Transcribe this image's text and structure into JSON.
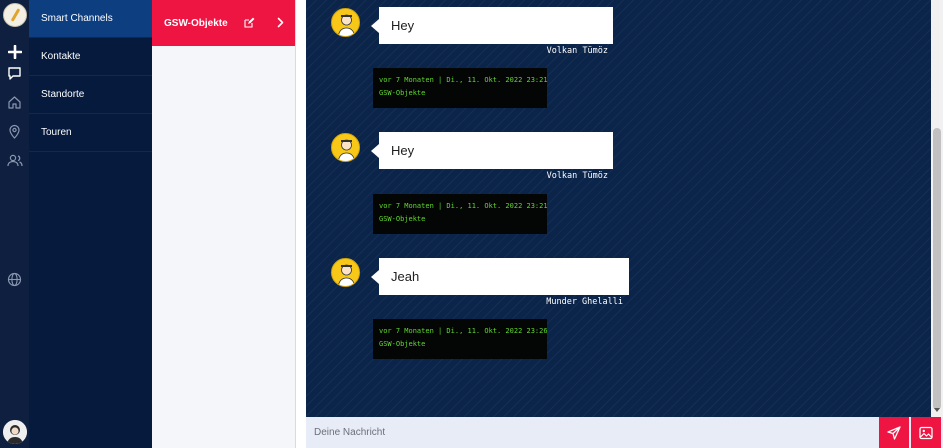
{
  "nav": {
    "items": [
      {
        "label": "Smart Channels",
        "active": true
      },
      {
        "label": "Kontakte",
        "active": false
      },
      {
        "label": "Standorte",
        "active": false
      },
      {
        "label": "Touren",
        "active": false
      }
    ]
  },
  "rail": {
    "icons": [
      "logo-icon",
      "plus-icon",
      "chat-icon",
      "home-icon",
      "location-pin-icon",
      "users-icon",
      "globe-icon",
      "profile-avatar"
    ]
  },
  "channels": {
    "items": [
      {
        "label": "GSW-Objekte",
        "color": "#ef1543"
      }
    ]
  },
  "messages": [
    {
      "text": "Hey",
      "author": "Volkan Tümöz",
      "meta_line1": "vor 7 Monaten | Di., 11. Okt. 2022 23:21",
      "meta_line2": "GSW-Objekte"
    },
    {
      "text": "Hey",
      "author": "Volkan Tümöz",
      "meta_line1": "vor 7 Monaten | Di., 11. Okt. 2022 23:21",
      "meta_line2": "GSW-Objekte"
    },
    {
      "text": "Jeah",
      "author": "Munder Ghelalli",
      "meta_line1": "vor 7 Monaten | Di., 11. Okt. 2022 23:26",
      "meta_line2": "GSW-Objekte"
    }
  ],
  "composer": {
    "placeholder": "Deine Nachricht",
    "value": ""
  },
  "colors": {
    "accent": "#ef1543",
    "chat_bg": "#0b2449",
    "nav_bg": "#061a3e",
    "nav_active": "#0d3e7f",
    "meta_text": "#5fd82e"
  }
}
